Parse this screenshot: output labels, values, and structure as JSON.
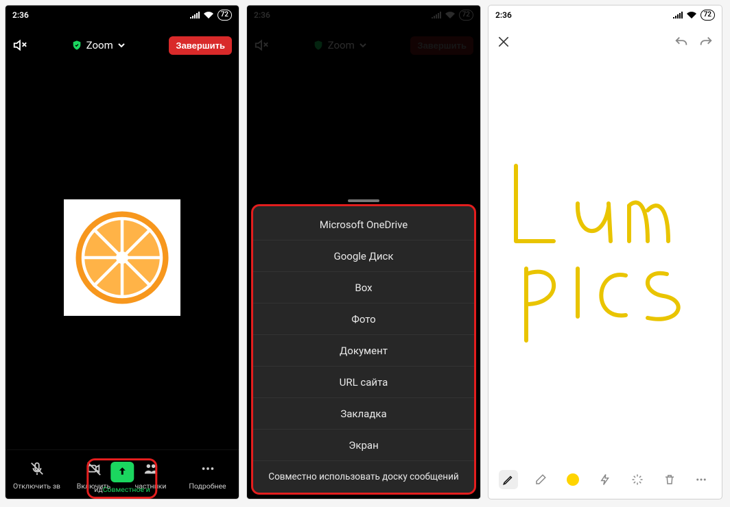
{
  "status": {
    "time": "2:36",
    "battery": "72"
  },
  "zoom": {
    "title": "Zoom",
    "end_label": "Завершить",
    "bar": {
      "mute": "Отключить зв",
      "video": "Включить",
      "share_prefix": "ид",
      "share": "Совместное и",
      "participants": "частники",
      "more": "Подробнее"
    }
  },
  "share_sheet": {
    "items": [
      "Microsoft OneDrive",
      "Google Диск",
      "Box",
      "Фото",
      "Документ",
      "URL сайта",
      "Закладка",
      "Экран",
      "Совместно использовать доску сообщений"
    ]
  },
  "whiteboard": {
    "drawing_text": "Lum pics",
    "color": "#ffd400"
  }
}
